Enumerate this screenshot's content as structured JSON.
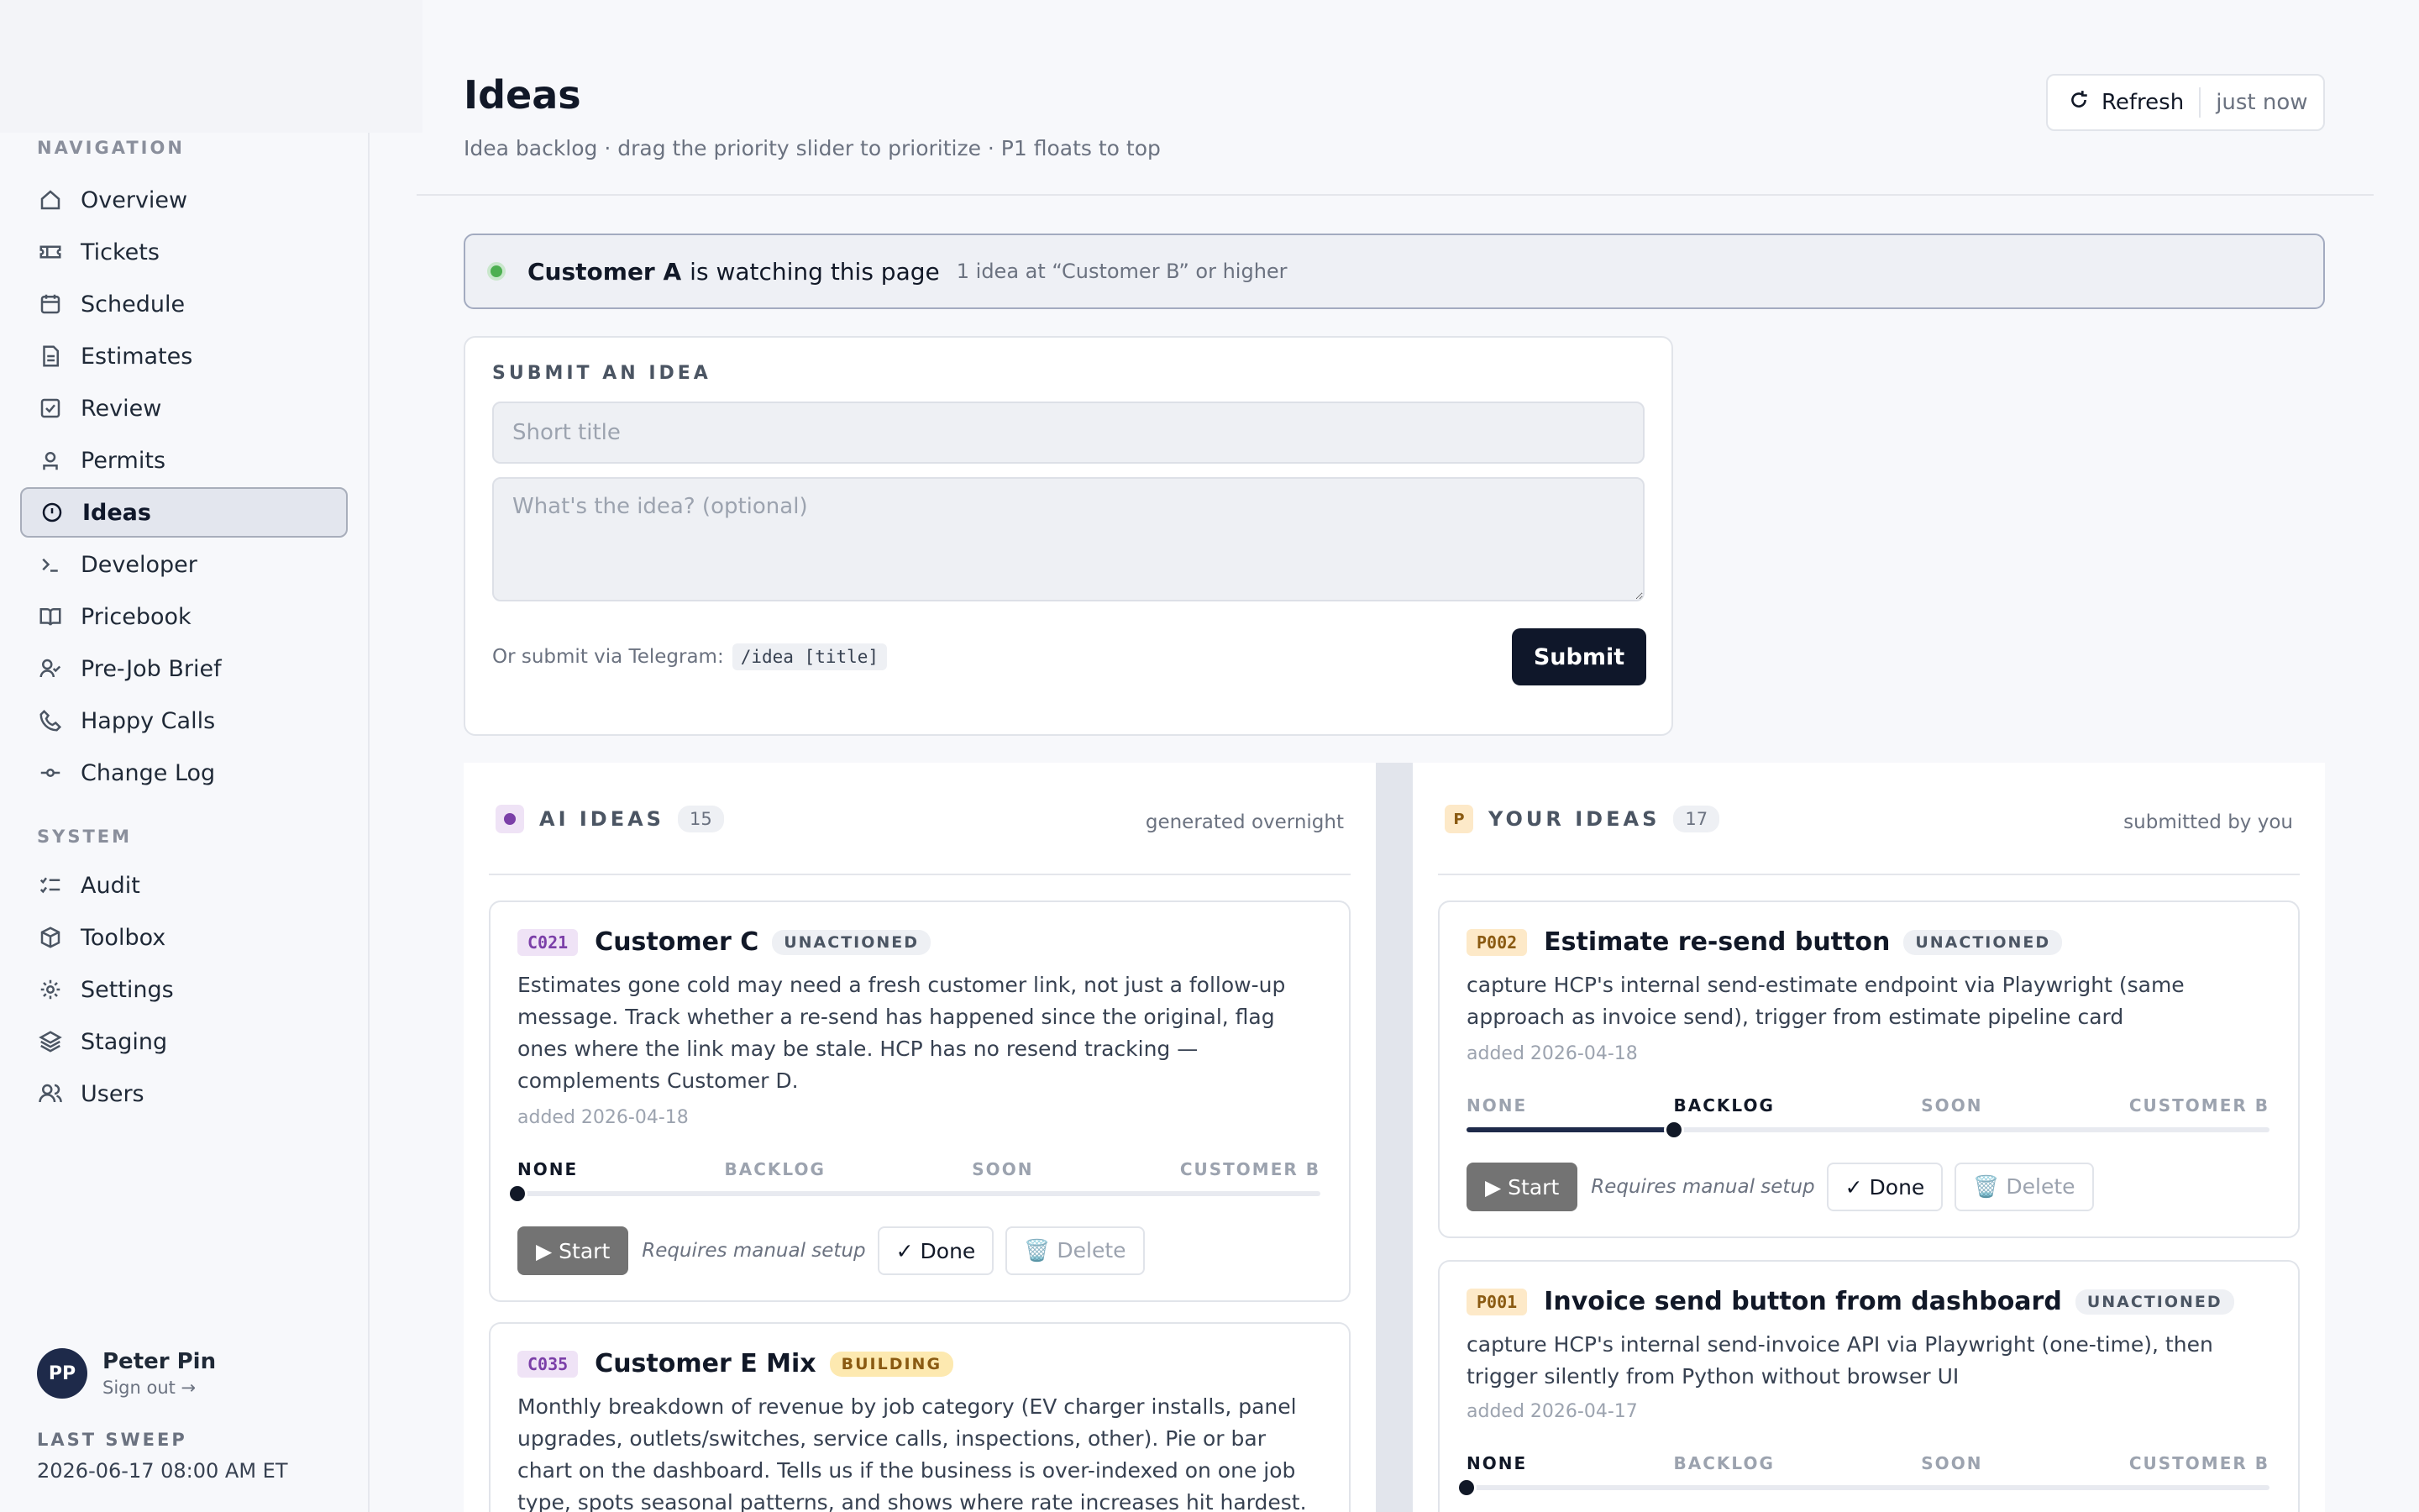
{
  "sidebar": {
    "nav_label": "NAVIGATION",
    "system_label": "SYSTEM",
    "nav_items": [
      {
        "label": "Overview",
        "icon": "home-icon"
      },
      {
        "label": "Tickets",
        "icon": "ticket-icon"
      },
      {
        "label": "Schedule",
        "icon": "calendar-icon"
      },
      {
        "label": "Estimates",
        "icon": "document-icon"
      },
      {
        "label": "Review",
        "icon": "checkbox-icon"
      },
      {
        "label": "Permits",
        "icon": "badge-icon"
      },
      {
        "label": "Ideas",
        "icon": "lightbulb-icon",
        "active": true
      },
      {
        "label": "Developer",
        "icon": "terminal-icon"
      },
      {
        "label": "Pricebook",
        "icon": "book-icon"
      },
      {
        "label": "Pre-Job Brief",
        "icon": "user-check-icon"
      },
      {
        "label": "Happy Calls",
        "icon": "phone-icon"
      },
      {
        "label": "Change Log",
        "icon": "commit-icon"
      }
    ],
    "system_items": [
      {
        "label": "Audit",
        "icon": "checklist-icon"
      },
      {
        "label": "Toolbox",
        "icon": "box-icon"
      },
      {
        "label": "Settings",
        "icon": "gear-icon"
      },
      {
        "label": "Staging",
        "icon": "layers-icon"
      },
      {
        "label": "Users",
        "icon": "users-icon"
      }
    ],
    "user": {
      "initials": "PP",
      "name": "Peter Pin",
      "signout": "Sign out →"
    },
    "last_sweep_label": "LAST SWEEP",
    "last_sweep_value": "2026-06-17 08:00 AM ET"
  },
  "header": {
    "title": "Ideas",
    "subtitle": "Idea backlog · drag the priority slider to prioritize · P1 floats to top",
    "refresh_label": "Refresh",
    "refresh_time": "just now"
  },
  "watch": {
    "name": "Customer A",
    "text": "is watching this page",
    "meta": "1 idea at “Customer B” or higher"
  },
  "submit": {
    "heading": "SUBMIT AN IDEA",
    "title_placeholder": "Short title",
    "desc_placeholder": "What's the idea? (optional)",
    "telegram_hint": "Or submit via Telegram:",
    "telegram_cmd": "/idea [title]",
    "button": "Submit"
  },
  "priority_levels": [
    "NONE",
    "BACKLOG",
    "SOON",
    "CUSTOMER B"
  ],
  "colors": {
    "ai_accent": "#7b3fa8",
    "ai_chip_bg": "#efe3f6",
    "yours_accent": "#8a5a12",
    "yours_chip_bg": "#fde9c8",
    "unactioned_bg": "#eef0f4",
    "building_bg": "#fde9b0",
    "building_text": "#8a5a12"
  },
  "ai_column": {
    "icon_letter": "",
    "title": "AI IDEAS",
    "count": "15",
    "note": "generated overnight",
    "ideas": [
      {
        "id": "C021",
        "title": "Customer C",
        "status": "UNACTIONED",
        "body": "Estimates gone cold may need a fresh customer link, not just a follow-up message. Track whether a re-send has happened since the original, flag ones where the link may be stale. HCP has no resend tracking — complements Customer D.",
        "date": "added 2026-04-18",
        "priority_level": 0,
        "start": "▶ Start",
        "manual": "Requires manual setup",
        "done": "✓ Done",
        "delete": "🗑️ Delete"
      },
      {
        "id": "C035",
        "title": "Customer E Mix",
        "status": "BUILDING",
        "body": "Monthly breakdown of revenue by job category (EV charger installs, panel upgrades, outlets/switches, service calls, inspections, other). Pie or bar chart on the dashboard. Tells us if the business is over-indexed on one job type, spots seasonal patterns, and shows where rate increases hit hardest."
      }
    ]
  },
  "yours_column": {
    "icon_letter": "P",
    "title": "YOUR IDEAS",
    "count": "17",
    "note": "submitted by you",
    "ideas": [
      {
        "id": "P002",
        "title": "Estimate re-send button",
        "status": "UNACTIONED",
        "body": "capture HCP's internal send-estimate endpoint via Playwright (same approach as invoice send), trigger from estimate pipeline card",
        "date": "added 2026-04-18",
        "priority_level": 1,
        "start": "▶ Start",
        "manual": "Requires manual setup",
        "done": "✓ Done",
        "delete": "🗑️ Delete"
      },
      {
        "id": "P001",
        "title": "Invoice send button from dashboard",
        "status": "UNACTIONED",
        "body": "capture HCP's internal send-invoice API via Playwright (one-time), then trigger silently from Python without browser UI",
        "date": "added 2026-04-17",
        "priority_level": 0
      }
    ]
  }
}
